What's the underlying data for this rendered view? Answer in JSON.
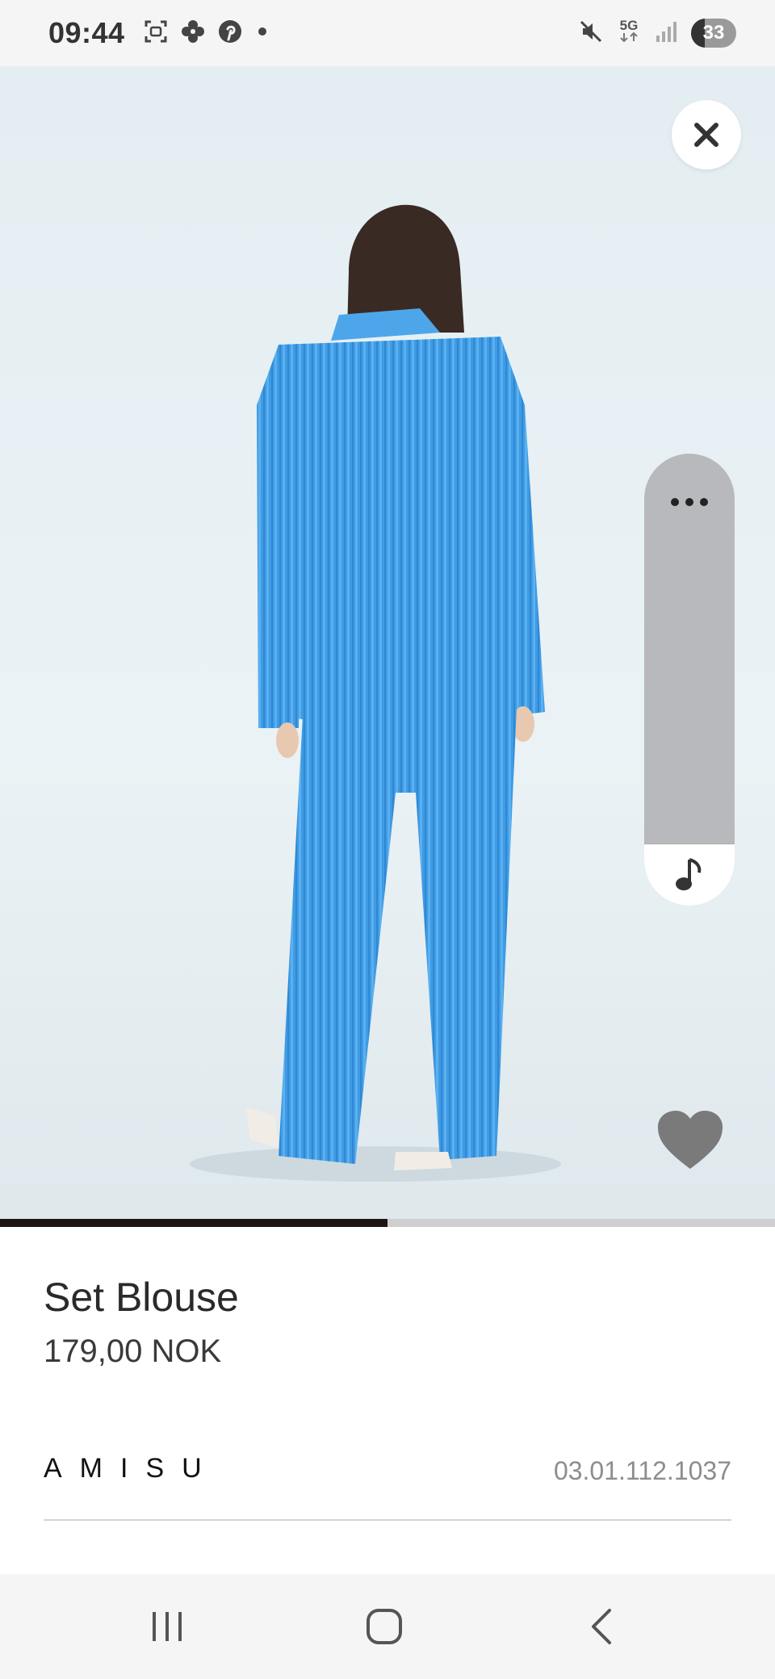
{
  "status_bar": {
    "time": "09:44",
    "network": "5G",
    "battery": "33",
    "battery_level": 0.33,
    "icons": [
      "screenshot-icon",
      "flower-icon",
      "pinterest-icon",
      "dot-icon",
      "mute-icon",
      "5g-icon",
      "signal-icon",
      "battery-icon"
    ]
  },
  "viewer": {
    "close_icon": "close-icon",
    "more_icon": "more-icon",
    "music_icon": "music-note-icon",
    "favorite_icon": "heart-icon",
    "image_progress": 0.5
  },
  "product": {
    "name": "Set Blouse",
    "price": "179,00 NOK",
    "brand": "AMISU",
    "code": "03.01.112.1037"
  },
  "nav": {
    "recents_icon": "recents-icon",
    "home_icon": "home-icon",
    "back_icon": "back-icon"
  },
  "colors": {
    "garment_blue": "#3f9be3",
    "progress": "#1e1510",
    "heart": "#7a7a7a"
  }
}
